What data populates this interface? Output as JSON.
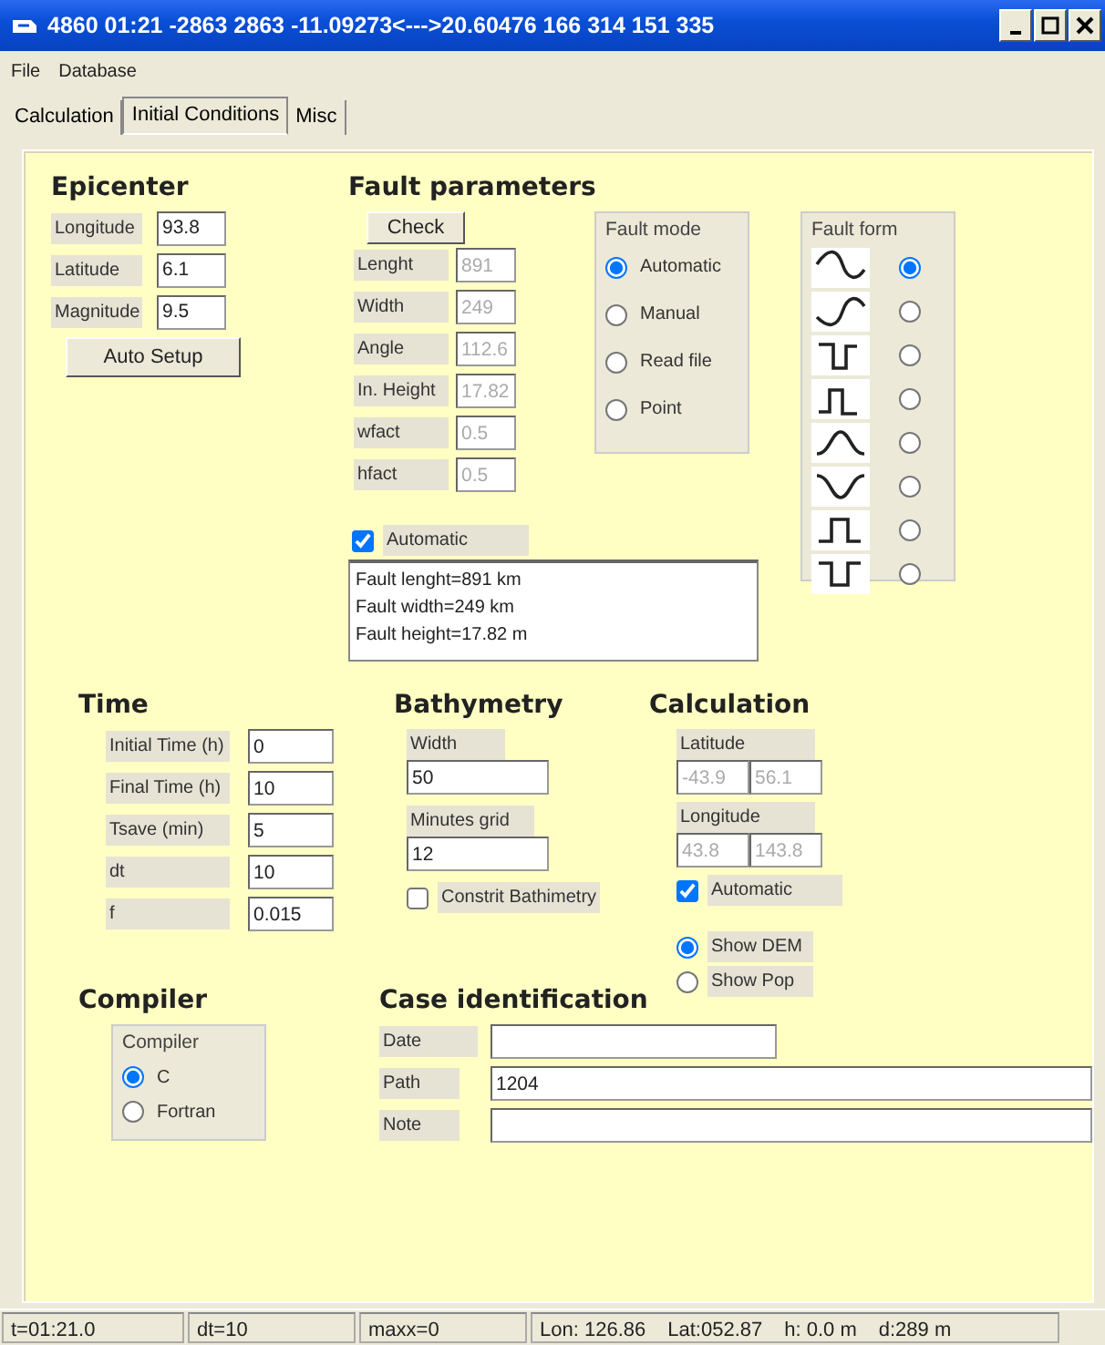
{
  "window": {
    "title": "4860  01:21 -2863 2863  -11.09273<--->20.60476 166 314 151 335"
  },
  "menu": [
    "File",
    "Database"
  ],
  "tabs": [
    {
      "label": "Calculation",
      "selected": false
    },
    {
      "label": "Initial Conditions",
      "selected": true
    },
    {
      "label": "Misc",
      "selected": false
    }
  ],
  "epicenter": {
    "heading": "Epicenter",
    "fields": [
      {
        "label": "Longitude",
        "value": "93.8"
      },
      {
        "label": "Latitude",
        "value": "6.1"
      },
      {
        "label": "Magnitude",
        "value": "9.5"
      }
    ],
    "button": "Auto Setup"
  },
  "fault_parameters": {
    "heading": "Fault parameters",
    "check_button": "Check",
    "fields": [
      {
        "label": "Lenght",
        "value": "891",
        "disabled": true
      },
      {
        "label": "Width",
        "value": "249",
        "disabled": true
      },
      {
        "label": "Angle",
        "value": "112.6",
        "disabled": true
      },
      {
        "label": "In. Height",
        "value": "17.82",
        "disabled": true
      },
      {
        "label": "wfact",
        "value": "0.5",
        "disabled": true
      },
      {
        "label": "hfact",
        "value": "0.5",
        "disabled": true
      }
    ],
    "automatic": {
      "label": "Automatic",
      "checked": true
    },
    "summary": [
      "Fault lenght=891 km",
      "Fault width=249 km",
      "Fault height=17.82 m"
    ],
    "fault_mode": {
      "legend": "Fault mode",
      "options": [
        {
          "label": "Automatic",
          "selected": true
        },
        {
          "label": "Manual",
          "selected": false
        },
        {
          "label": "Read file",
          "selected": false
        },
        {
          "label": "Point",
          "selected": false
        }
      ]
    },
    "fault_form": {
      "legend": "Fault form",
      "options": [
        {
          "selected": true
        },
        {
          "selected": false
        },
        {
          "selected": false
        },
        {
          "selected": false
        },
        {
          "selected": false
        },
        {
          "selected": false
        },
        {
          "selected": false
        },
        {
          "selected": false
        }
      ]
    }
  },
  "time": {
    "heading": "Time",
    "fields": [
      {
        "label": "Initial Time (h)",
        "value": "0"
      },
      {
        "label": "Final Time (h)",
        "value": "10"
      },
      {
        "label": "Tsave (min)",
        "value": "5"
      },
      {
        "label": "dt",
        "value": "10"
      },
      {
        "label": "f",
        "value": "0.015"
      }
    ]
  },
  "bathymetry": {
    "heading": "Bathymetry",
    "fields": [
      {
        "label": "Width",
        "value": "50"
      },
      {
        "label": "Minutes grid",
        "value": "12"
      }
    ],
    "constrain": {
      "label": "Constrit Bathimetry",
      "checked": false
    }
  },
  "calculation": {
    "heading": "Calculation",
    "ranges": [
      {
        "label": "Latitude",
        "min": "-43.9",
        "max": "56.1",
        "disabled": true
      },
      {
        "label": "Longitude",
        "min": "43.8",
        "max": "143.8",
        "disabled": true
      }
    ],
    "automatic": {
      "label": "Automatic",
      "checked": true
    },
    "display": [
      {
        "label": "Show DEM",
        "selected": true
      },
      {
        "label": "Show Pop",
        "selected": false
      }
    ]
  },
  "compiler": {
    "heading": "Compiler",
    "legend": "Compiler",
    "options": [
      {
        "label": "C",
        "selected": true
      },
      {
        "label": "Fortran",
        "selected": false
      }
    ]
  },
  "case_identification": {
    "heading": "Case identification",
    "fields": [
      {
        "label": "Date"
      },
      {
        "label": "Path",
        "value": "1204"
      },
      {
        "label": "Note"
      }
    ]
  },
  "status_bar": {
    "panels": [
      "t=01:21.0",
      "dt=10",
      "maxx=0"
    ],
    "position": [
      "Lon: 126.86",
      "Lat:052.87",
      "h: 0.0 m",
      "d:289 m"
    ]
  }
}
